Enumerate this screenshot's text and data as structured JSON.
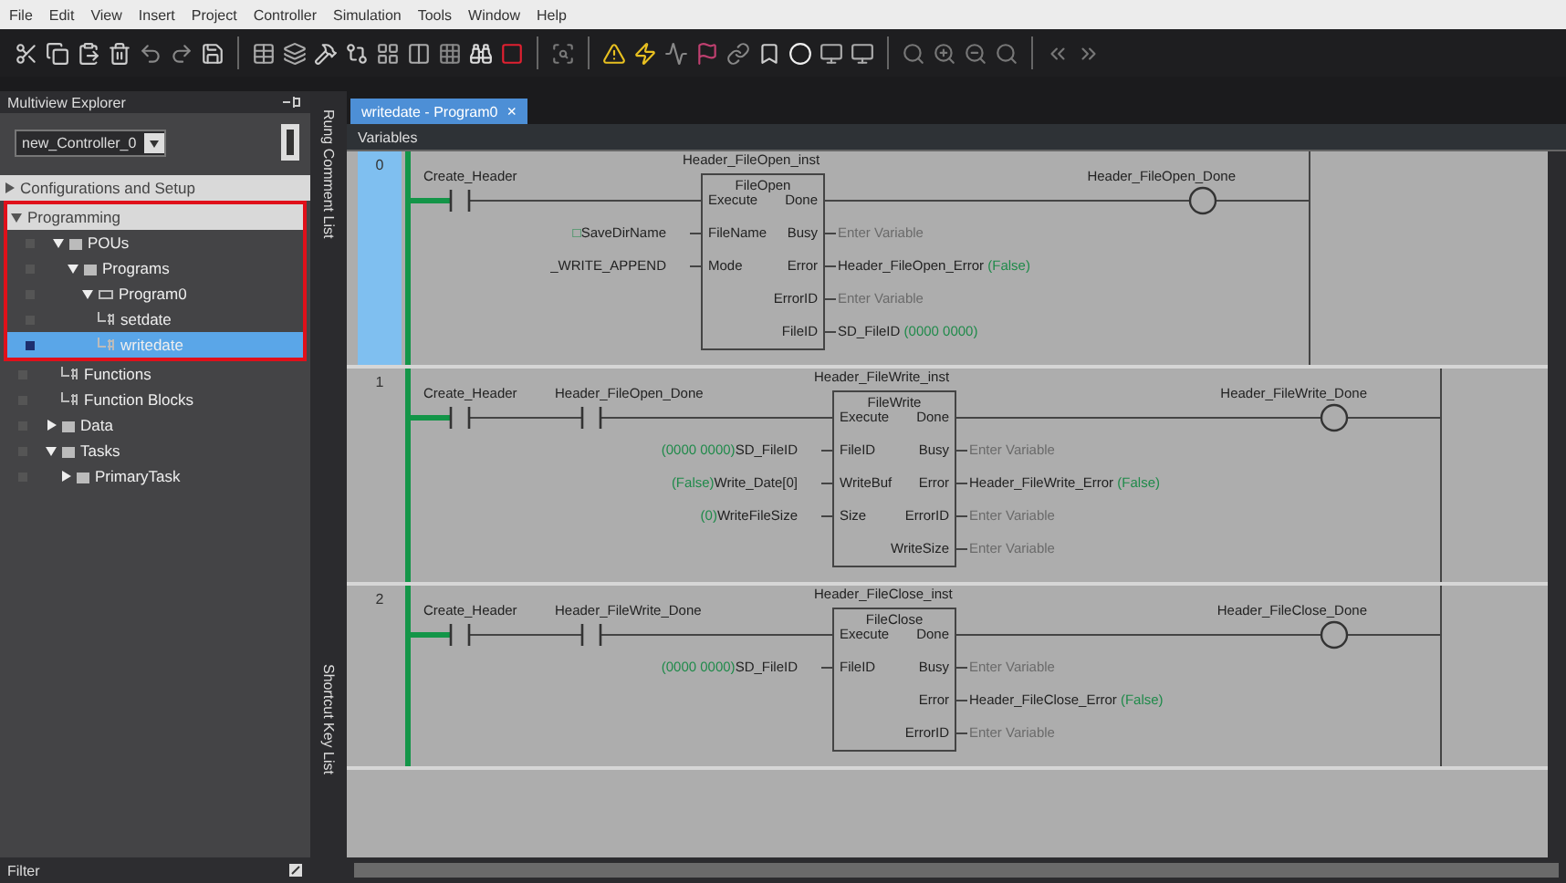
{
  "menu": [
    "File",
    "Edit",
    "View",
    "Insert",
    "Project",
    "Controller",
    "Simulation",
    "Tools",
    "Window",
    "Help"
  ],
  "explorer": {
    "title": "Multiview Explorer",
    "controller": "new_Controller_0",
    "filter": "Filter",
    "tree": [
      {
        "label": "Configurations and Setup",
        "kind": "section",
        "expanded": false,
        "selected": false
      },
      {
        "label": "Programming",
        "kind": "section",
        "expanded": true,
        "selected": false,
        "highlighted": true,
        "children": [
          {
            "label": "POUs",
            "kind": "folder",
            "expanded": true,
            "selected": false,
            "highlighted": true,
            "children": [
              {
                "label": "Programs",
                "kind": "folder",
                "expanded": true,
                "selected": false,
                "highlighted": true,
                "children": [
                  {
                    "label": "Program0",
                    "kind": "program",
                    "expanded": true,
                    "selected": false,
                    "highlighted": true,
                    "children": [
                      {
                        "label": "setdate",
                        "kind": "leaf",
                        "selected": false,
                        "highlighted": true
                      },
                      {
                        "label": "writedate",
                        "kind": "leaf",
                        "selected": true,
                        "highlighted": true
                      }
                    ]
                  }
                ]
              },
              {
                "label": "Functions",
                "kind": "leaf",
                "selected": false
              },
              {
                "label": "Function Blocks",
                "kind": "leaf",
                "selected": false
              }
            ]
          },
          {
            "label": "Data",
            "kind": "folder",
            "expanded": false,
            "selected": false
          },
          {
            "label": "Tasks",
            "kind": "folder",
            "expanded": true,
            "selected": false,
            "children": [
              {
                "label": "PrimaryTask",
                "kind": "folder",
                "expanded": false,
                "selected": false
              }
            ]
          }
        ]
      }
    ]
  },
  "side_tabs": [
    "Rung Comment List",
    "Shortcut Key List"
  ],
  "editor_tabs": [
    {
      "label": "writedate - Program0",
      "selected": true,
      "close": "×"
    }
  ],
  "variables_bar": "Variables",
  "rungs": [
    {
      "number": "0",
      "selected": true,
      "contacts": [
        "Create_Header"
      ],
      "instance": "Header_FileOpen_inst",
      "block": "FileOpen",
      "coil": "Header_FileOpen_Done",
      "inputs": [
        {
          "pin": "Execute"
        },
        {
          "pin": "FileName",
          "variable": "SaveDirName",
          "value": "□"
        },
        {
          "pin": "Mode",
          "variable": "_WRITE_APPEND"
        }
      ],
      "outputs": [
        {
          "pin": "Done"
        },
        {
          "pin": "Busy",
          "placeholder": "Enter Variable"
        },
        {
          "pin": "Error",
          "variable": "Header_FileOpen_Error",
          "value": "(False)"
        },
        {
          "pin": "ErrorID",
          "placeholder": "Enter Variable"
        },
        {
          "pin": "FileID",
          "variable": "SD_FileID",
          "value": "(0000 0000)"
        }
      ]
    },
    {
      "number": "1",
      "selected": false,
      "contacts": [
        "Create_Header",
        "Header_FileOpen_Done"
      ],
      "instance": "Header_FileWrite_inst",
      "block": "FileWrite",
      "coil": "Header_FileWrite_Done",
      "inputs": [
        {
          "pin": "Execute"
        },
        {
          "pin": "FileID",
          "variable": "SD_FileID",
          "value": "(0000 0000)"
        },
        {
          "pin": "WriteBuf",
          "variable": "Write_Date[0]",
          "value": "(False)"
        },
        {
          "pin": "Size",
          "variable": "WriteFileSize",
          "value": "(0)"
        }
      ],
      "outputs": [
        {
          "pin": "Done"
        },
        {
          "pin": "Busy",
          "placeholder": "Enter Variable"
        },
        {
          "pin": "Error",
          "variable": "Header_FileWrite_Error",
          "value": "(False)"
        },
        {
          "pin": "ErrorID",
          "placeholder": "Enter Variable"
        },
        {
          "pin": "WriteSize",
          "placeholder": "Enter Variable"
        }
      ]
    },
    {
      "number": "2",
      "selected": false,
      "contacts": [
        "Create_Header",
        "Header_FileWrite_Done"
      ],
      "instance": "Header_FileClose_inst",
      "block": "FileClose",
      "coil": "Header_FileClose_Done",
      "inputs": [
        {
          "pin": "Execute"
        },
        {
          "pin": "FileID",
          "variable": "SD_FileID",
          "value": "(0000 0000)"
        }
      ],
      "outputs": [
        {
          "pin": "Done"
        },
        {
          "pin": "Busy",
          "placeholder": "Enter Variable"
        },
        {
          "pin": "Error",
          "variable": "Header_FileClose_Error",
          "value": "(False)"
        },
        {
          "pin": "ErrorID",
          "placeholder": "Enter Variable"
        }
      ]
    }
  ]
}
